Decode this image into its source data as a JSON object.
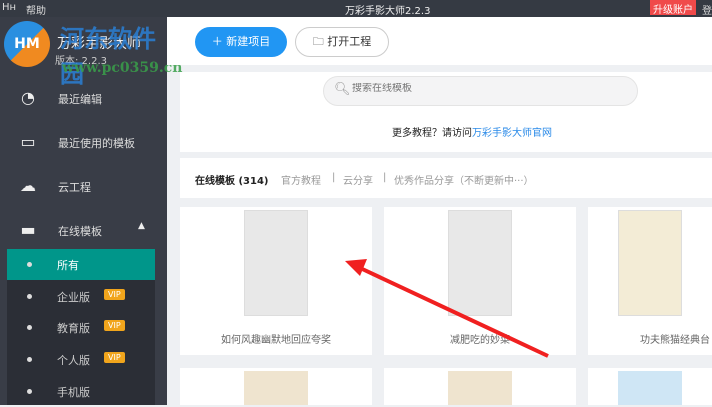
{
  "topbar": {
    "menu_file": "Hн",
    "menu_help": "帮助",
    "title": "万彩手影大师2.2.3",
    "upgrade": "升级账户",
    "user": "登"
  },
  "logo": {
    "mark": "HM",
    "name": "万彩手影大师",
    "version": "版本: 2.2.3"
  },
  "watermark": {
    "line1": "河东软件园",
    "line2": "www.pc0359.cn"
  },
  "sidebar": {
    "items": [
      {
        "label": "最近编辑",
        "icon": "clock-icon"
      },
      {
        "label": "最近使用的模板",
        "icon": "monitor-icon"
      },
      {
        "label": "云工程",
        "icon": "cloud-icon"
      },
      {
        "label": "在线模板",
        "icon": "template-icon"
      }
    ],
    "subitems": [
      {
        "label": "所有",
        "vip": ""
      },
      {
        "label": "企业版",
        "vip": "VIP"
      },
      {
        "label": "教育版",
        "vip": "VIP"
      },
      {
        "label": "个人版",
        "vip": "VIP"
      },
      {
        "label": "手机版",
        "vip": ""
      }
    ]
  },
  "header": {
    "new_project": "新建项目",
    "open_project": "打开工程"
  },
  "search": {
    "placeholder": "搜索在线模板"
  },
  "more": {
    "prefix": "更多教程？请访问",
    "link": "万彩手影大师官网"
  },
  "tabs": {
    "online": "在线模板 (314)",
    "official": "官方教程",
    "sep1": "|",
    "cloud": "云分享",
    "sep2": "|",
    "excellent": "优秀作品分享（不断更新中···）"
  },
  "cards": [
    {
      "title": "如何风趣幽默地回应夸奖"
    },
    {
      "title": "减肥吃的妙菜"
    },
    {
      "title": "功夫熊猫经典台"
    }
  ],
  "colors": {
    "accent": "#2196f3",
    "active": "#00968a",
    "vip": "#f1a51c",
    "arrow": "#f02020"
  }
}
